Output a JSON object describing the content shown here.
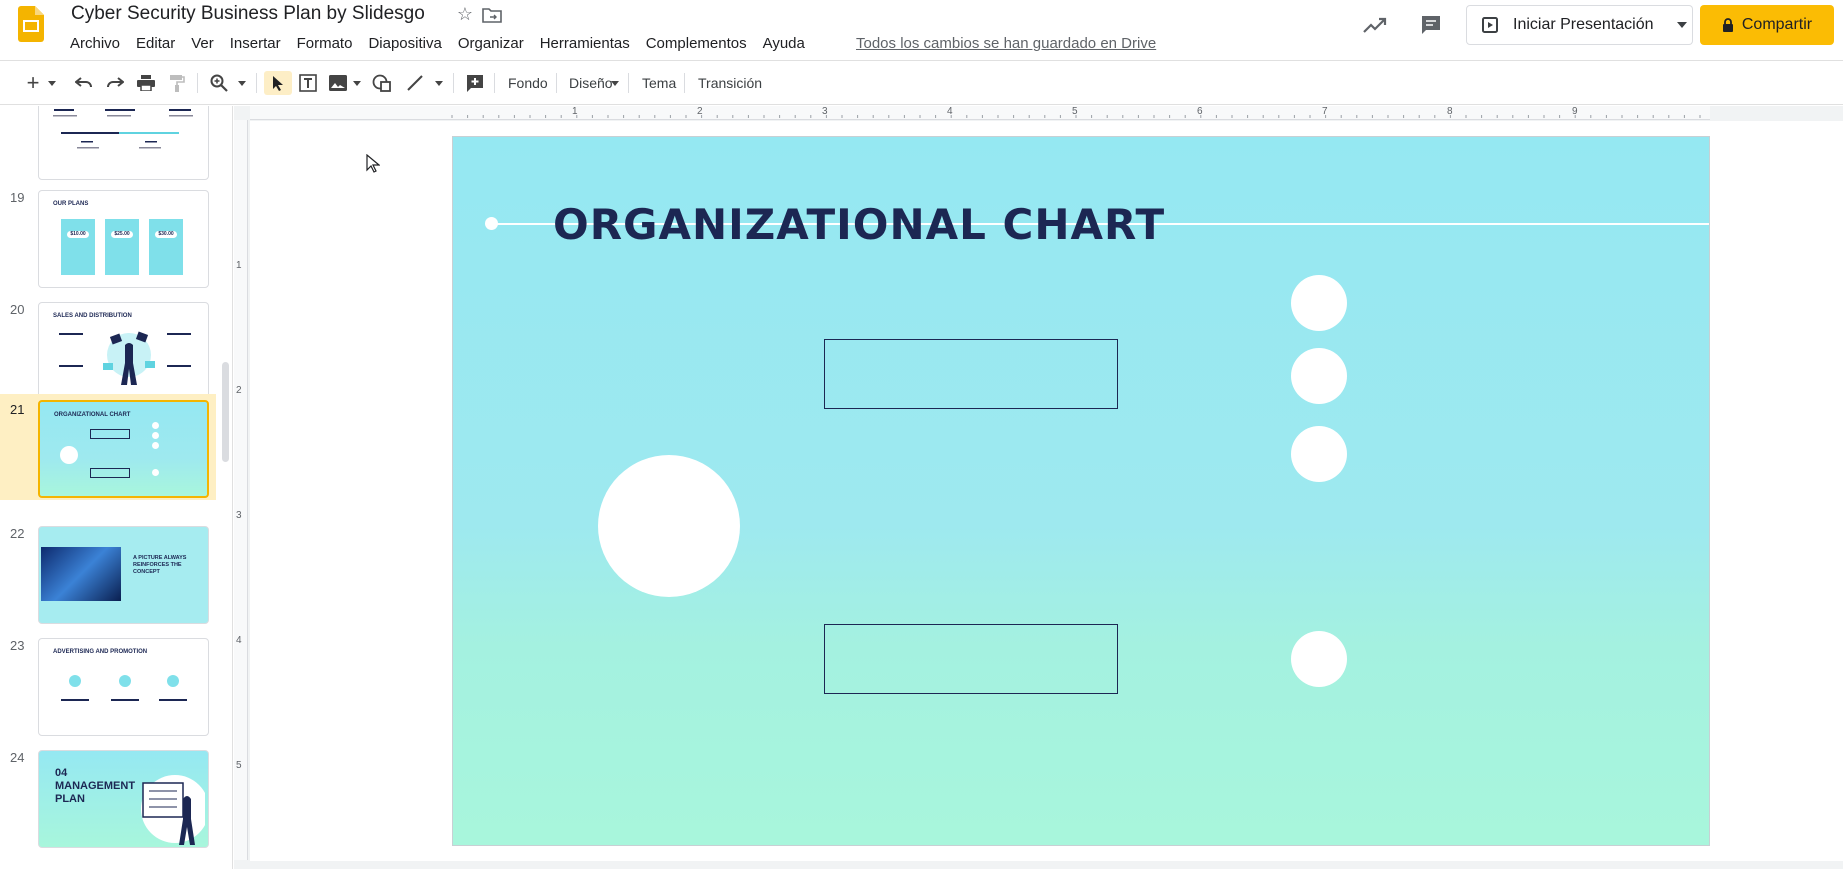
{
  "header": {
    "title": "Cyber Security Business Plan by Slidesgo",
    "saved_status": "Todos los cambios se han guardado en Drive",
    "menu": [
      "Archivo",
      "Editar",
      "Ver",
      "Insertar",
      "Formato",
      "Diapositiva",
      "Organizar",
      "Herramientas",
      "Complementos",
      "Ayuda"
    ],
    "present_label": "Iniciar Presentación",
    "share_label": "Compartir"
  },
  "toolbar": {
    "background_label": "Fondo",
    "layout_label": "Diseño",
    "theme_label": "Tema",
    "transition_label": "Transición"
  },
  "filmstrip": {
    "slides": [
      {
        "num": "19",
        "title": "OUR PLANS"
      },
      {
        "num": "20",
        "title": "SALES AND DISTRIBUTION"
      },
      {
        "num": "21",
        "title": "ORGANIZATIONAL CHART"
      },
      {
        "num": "22",
        "title": "A PICTURE ALWAYS REINFORCES THE CONCEPT"
      },
      {
        "num": "23",
        "title": "ADVERTISING AND PROMOTION"
      },
      {
        "num": "24",
        "title": "04 MANAGEMENT PLAN"
      }
    ],
    "prices": [
      "$10.00",
      "$25.00",
      "$30.00"
    ]
  },
  "ruler": {
    "top": [
      "1",
      "2",
      "3",
      "4",
      "5",
      "6",
      "7",
      "8",
      "9"
    ],
    "left": [
      "1",
      "2",
      "3",
      "4",
      "5"
    ]
  },
  "slide": {
    "title": "ORGANIZATIONAL CHART"
  },
  "colors": {
    "accent": "#fbbc04",
    "slide_title": "#1c2753",
    "slide_bg_top": "#95e8f2",
    "slide_bg_bottom": "#a8f6dc"
  }
}
